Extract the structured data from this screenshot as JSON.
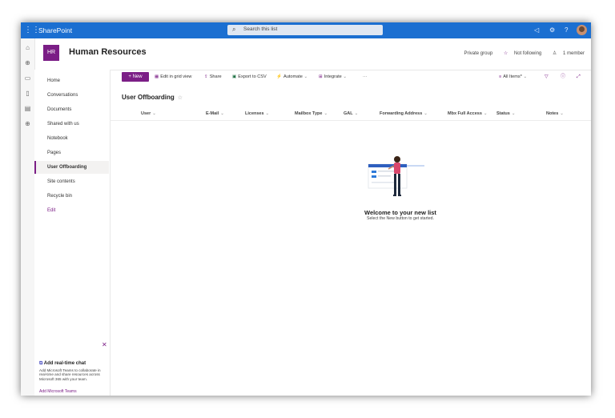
{
  "app": {
    "brand": "SharePoint",
    "search_placeholder": "Search this list"
  },
  "site": {
    "logo_initials": "HR",
    "title": "Human Resources",
    "privacy": "Private group",
    "follow": "Not following",
    "members": "1 member"
  },
  "nav": {
    "items": [
      {
        "label": "Home"
      },
      {
        "label": "Conversations"
      },
      {
        "label": "Documents"
      },
      {
        "label": "Shared with us"
      },
      {
        "label": "Notebook"
      },
      {
        "label": "Pages"
      },
      {
        "label": "User Offboarding"
      },
      {
        "label": "Site contents"
      },
      {
        "label": "Recycle bin"
      },
      {
        "label": "Edit"
      }
    ]
  },
  "teams_card": {
    "title": "Add real-time chat",
    "description": "Add Microsoft Teams to collaborate in real-time and share resources across Microsoft 365 with your team.",
    "link": "Add Microsoft Teams"
  },
  "commands": {
    "new": "+ New",
    "grid": "Edit in grid view",
    "share": "Share",
    "export": "Export to CSV",
    "automate": "Automate",
    "integrate": "Integrate",
    "more": "···",
    "view": "All Items*"
  },
  "list": {
    "title": "User Offboarding",
    "columns": [
      "User",
      "E-Mail",
      "Licenses",
      "Mailbox Type",
      "GAL",
      "Forwarding Address",
      "Mbx Full Access",
      "Status",
      "Notes"
    ]
  },
  "empty": {
    "title": "Welcome to your new list",
    "subtitle": "Select the New button to get started."
  },
  "colors": {
    "suite_bar": "#1b6fd1",
    "accent": "#7b1e86"
  }
}
